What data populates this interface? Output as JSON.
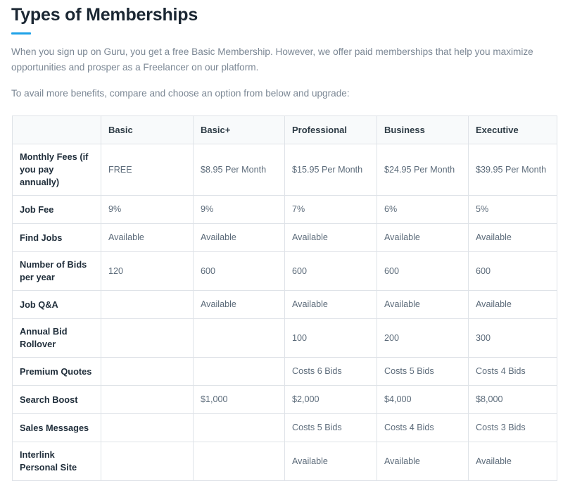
{
  "header": {
    "title": "Types of Memberships",
    "accent_color": "#1fa2e8",
    "paragraph_1": "When you sign up on Guru, you get a free Basic Membership. However, we offer paid memberships that help you maximize opportunities and prosper as a Freelancer on our platform.",
    "paragraph_2": "To avail more benefits, compare and choose an option from below and upgrade:"
  },
  "table": {
    "corner_label": "",
    "columns": [
      "Basic",
      "Basic+",
      "Professional",
      "Business",
      "Executive"
    ],
    "rows": [
      {
        "label": "Monthly Fees (if you pay annually)",
        "tall": true,
        "values": [
          "FREE",
          "$8.95 Per Month",
          "$15.95 Per Month",
          "$24.95 Per Month",
          "$39.95 Per Month"
        ]
      },
      {
        "label": "Job Fee",
        "tall": false,
        "values": [
          "9%",
          "9%",
          "7%",
          "6%",
          "5%"
        ]
      },
      {
        "label": "Find Jobs",
        "tall": false,
        "values": [
          "Available",
          "Available",
          "Available",
          "Available",
          "Available"
        ]
      },
      {
        "label": "Number of Bids per year",
        "tall": true,
        "values": [
          "120",
          "600",
          "600",
          "600",
          "600"
        ]
      },
      {
        "label": "Job Q&A",
        "tall": false,
        "values": [
          "",
          "Available",
          "Available",
          "Available",
          "Available"
        ]
      },
      {
        "label": "Annual Bid Rollover",
        "tall": true,
        "values": [
          "",
          "",
          "100",
          "200",
          "300"
        ]
      },
      {
        "label": "Premium Quotes",
        "tall": false,
        "values": [
          "",
          "",
          "Costs 6 Bids",
          "Costs 5 Bids",
          "Costs 4 Bids"
        ]
      },
      {
        "label": "Search Boost",
        "tall": false,
        "values": [
          "",
          "$1,000",
          "$2,000",
          "$4,000",
          "$8,000"
        ]
      },
      {
        "label": "Sales Messages",
        "tall": false,
        "values": [
          "",
          "",
          "Costs 5 Bids",
          "Costs 4 Bids",
          "Costs 3 Bids"
        ]
      },
      {
        "label": "Interlink Personal Site",
        "tall": true,
        "values": [
          "",
          "",
          "Available",
          "Available",
          "Available"
        ]
      }
    ]
  },
  "colors": {
    "title": "#1b2733",
    "body_text": "#7b8794",
    "table_border": "#dfe3e8",
    "header_bg": "#f8fafb",
    "row_label": "#1f2d3a",
    "cell_value": "#5c6b7a"
  }
}
